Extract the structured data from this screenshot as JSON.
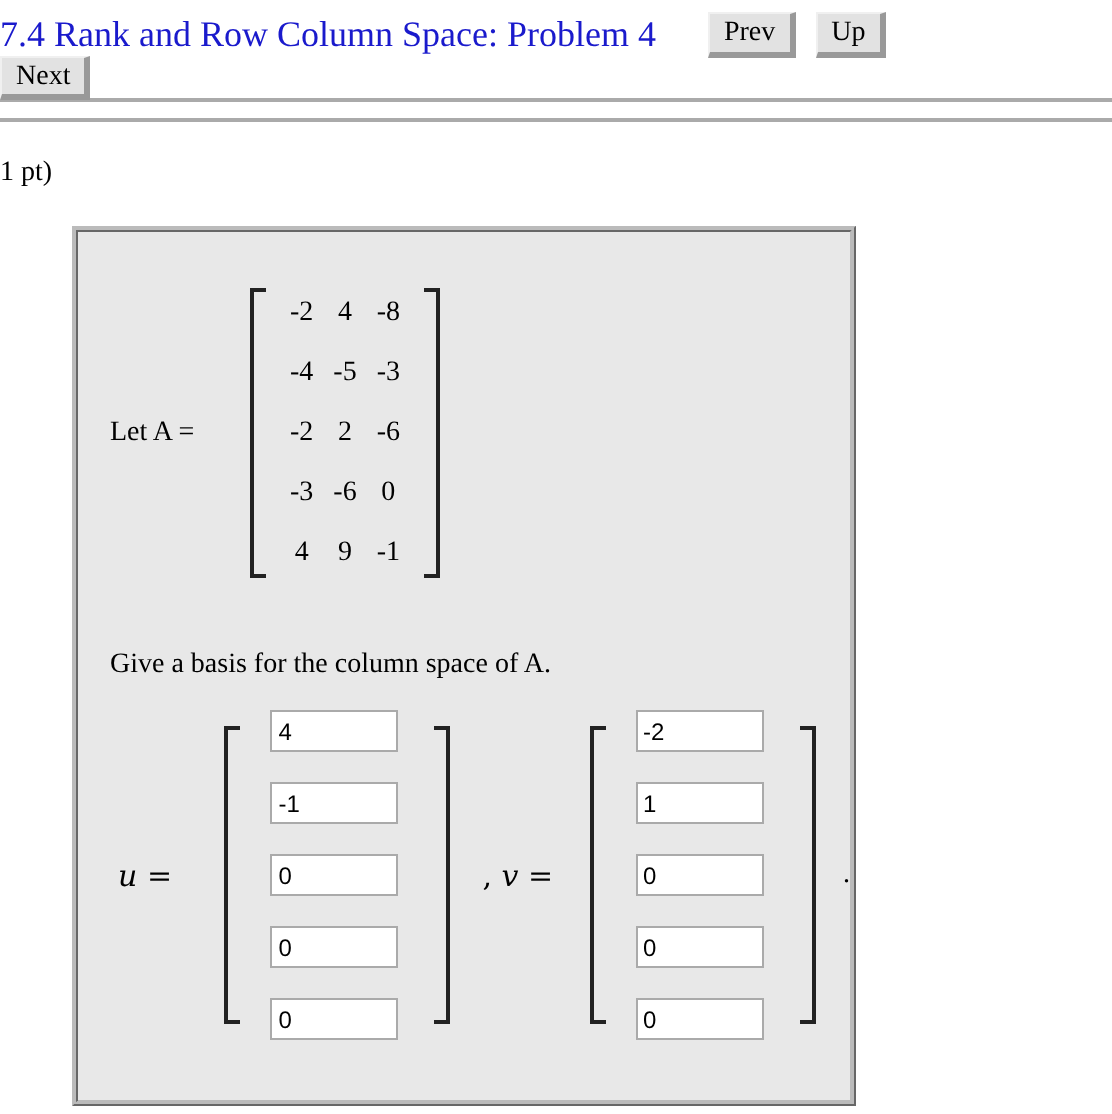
{
  "header": {
    "title": "7.4 Rank and Row Column Space: Problem 4",
    "nav_buttons": [
      {
        "label": "Prev"
      },
      {
        "label": "Up"
      }
    ],
    "next_button": {
      "label": "Next"
    }
  },
  "points": "1 pt)",
  "problem": {
    "intro": "Let A =",
    "matrix": [
      [
        "-2",
        "4",
        "-8"
      ],
      [
        "-4",
        "-5",
        "-3"
      ],
      [
        "-2",
        "2",
        "-6"
      ],
      [
        "-3",
        "-6",
        "0"
      ],
      [
        "4",
        "9",
        "-1"
      ]
    ],
    "question": "Give a basis for the column space of A.",
    "vectors": [
      {
        "label": "*u* =",
        "values": [
          "4",
          "-1",
          "0",
          "0",
          "0"
        ]
      },
      {
        "label": ", *v* =",
        "values": [
          "-2",
          "1",
          "0",
          "0",
          "0"
        ]
      }
    ],
    "end": "."
  }
}
